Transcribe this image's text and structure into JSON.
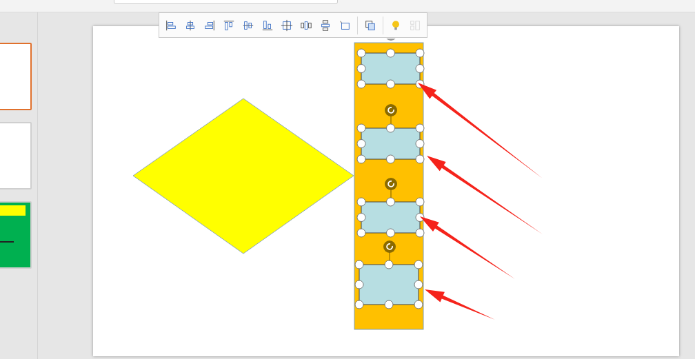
{
  "slides": [
    {
      "selected": true,
      "kind": "blank"
    },
    {
      "selected": false,
      "kind": "blank"
    },
    {
      "selected": false,
      "kind": "green"
    }
  ],
  "align_toolbar": {
    "buttons": [
      {
        "kind": "align-left",
        "disabled": false
      },
      {
        "kind": "align-center",
        "disabled": false
      },
      {
        "kind": "align-right",
        "disabled": false
      },
      {
        "kind": "align-top",
        "disabled": false
      },
      {
        "kind": "align-middle",
        "disabled": false
      },
      {
        "kind": "align-bottom",
        "disabled": false
      },
      {
        "kind": "center",
        "disabled": false
      },
      {
        "kind": "distribute-horizontal",
        "disabled": false
      },
      {
        "kind": "distribute-vertical",
        "disabled": false
      },
      {
        "kind": "crop",
        "disabled": false
      },
      {
        "kind": "separator"
      },
      {
        "kind": "group",
        "disabled": false
      },
      {
        "kind": "separator"
      },
      {
        "kind": "idea",
        "disabled": false
      },
      {
        "kind": "panel",
        "disabled": true
      }
    ]
  }
}
